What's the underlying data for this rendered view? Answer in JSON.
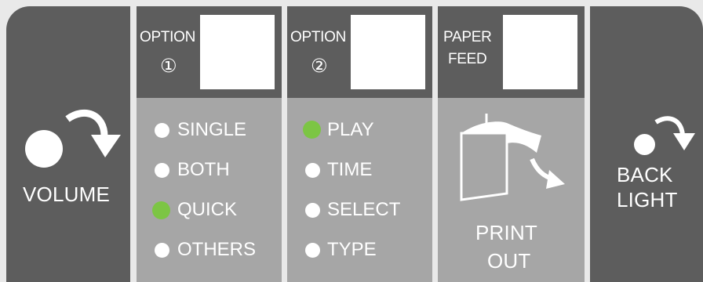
{
  "volume": {
    "label": "VOLUME"
  },
  "option1": {
    "title": "OPTION",
    "number": "①",
    "items": [
      {
        "label": "SINGLE",
        "selected": false
      },
      {
        "label": "BOTH",
        "selected": false
      },
      {
        "label": "QUICK",
        "selected": true
      },
      {
        "label": "OTHERS",
        "selected": false
      }
    ]
  },
  "option2": {
    "title": "OPTION",
    "number": "②",
    "items": [
      {
        "label": "PLAY",
        "selected": true
      },
      {
        "label": "TIME",
        "selected": false
      },
      {
        "label": "SELECT",
        "selected": false
      },
      {
        "label": "TYPE",
        "selected": false
      }
    ]
  },
  "paper_feed": {
    "line1": "PAPER",
    "line2": "FEED"
  },
  "print_out": {
    "line1": "PRINT",
    "line2": "OUT"
  },
  "back_light": {
    "line1": "BACK",
    "line2": "LIGHT"
  },
  "colors": {
    "dark": "#5d5d5d",
    "light": "#a6a6a6",
    "selected": "#7cc544",
    "unselected": "#ffffff"
  }
}
